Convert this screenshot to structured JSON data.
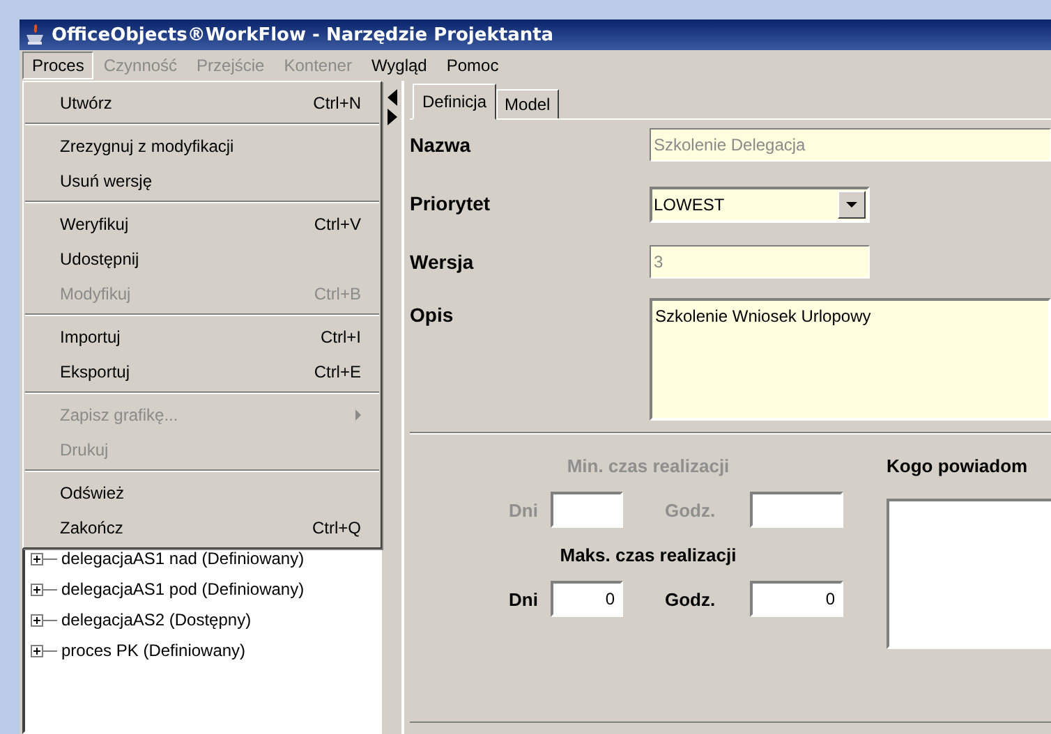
{
  "window": {
    "title": "OfficeObjects®WorkFlow - Narzędzie Projektanta"
  },
  "menubar": [
    {
      "label": "Proces",
      "selected": true,
      "disabled": false
    },
    {
      "label": "Czynność",
      "selected": false,
      "disabled": true
    },
    {
      "label": "Przejście",
      "selected": false,
      "disabled": true
    },
    {
      "label": "Kontener",
      "selected": false,
      "disabled": true
    },
    {
      "label": "Wygląd",
      "selected": false,
      "disabled": false
    },
    {
      "label": "Pomoc",
      "selected": false,
      "disabled": false
    }
  ],
  "menu": {
    "items": [
      {
        "kind": "item",
        "label": "Utwórz",
        "shortcut": "Ctrl+N",
        "disabled": false
      },
      {
        "kind": "separator"
      },
      {
        "kind": "item",
        "label": "Zrezygnuj z modyfikacji",
        "disabled": false
      },
      {
        "kind": "item",
        "label": "Usuń wersję",
        "disabled": false
      },
      {
        "kind": "separator"
      },
      {
        "kind": "item",
        "label": "Weryfikuj",
        "shortcut": "Ctrl+V",
        "disabled": false
      },
      {
        "kind": "item",
        "label": "Udostępnij",
        "disabled": false
      },
      {
        "kind": "item",
        "label": "Modyfikuj",
        "shortcut": "Ctrl+B",
        "disabled": true
      },
      {
        "kind": "separator"
      },
      {
        "kind": "item",
        "label": "Importuj",
        "shortcut": "Ctrl+I",
        "disabled": false
      },
      {
        "kind": "item",
        "label": "Eksportuj",
        "shortcut": "Ctrl+E",
        "disabled": false
      },
      {
        "kind": "separator"
      },
      {
        "kind": "submenu",
        "label": "Zapisz grafikę...",
        "disabled": true
      },
      {
        "kind": "item",
        "label": "Drukuj",
        "disabled": true
      },
      {
        "kind": "separator"
      },
      {
        "kind": "item",
        "label": "Odśwież",
        "disabled": false
      },
      {
        "kind": "item",
        "label": "Zakończ",
        "shortcut": "Ctrl+Q",
        "disabled": false
      }
    ]
  },
  "tree": {
    "items": [
      {
        "label": "delegacjaAS1 nad (Definiowany)",
        "expanded": false
      },
      {
        "label": "delegacjaAS1 pod (Definiowany)",
        "expanded": false
      },
      {
        "label": "delegacjaAS2 (Dostępny)",
        "expanded": false
      },
      {
        "label": "proces PK (Definiowany)",
        "expanded": false
      }
    ]
  },
  "tabs": [
    {
      "label": "Definicja",
      "selected": true
    },
    {
      "label": "Model",
      "selected": false
    }
  ],
  "form": {
    "name": {
      "label": "Nazwa",
      "value": "Szkolenie Delegacja",
      "disabled": true
    },
    "priority": {
      "label": "Priorytet",
      "value": "LOWEST"
    },
    "version": {
      "label": "Wersja",
      "value": "3",
      "disabled": true
    },
    "description": {
      "label": "Opis",
      "value": "Szkolenie Wniosek Urlopowy"
    }
  },
  "min_time": {
    "title": "Min. czas realizacji",
    "disabled": true,
    "days_label": "Dni",
    "hours_label": "Godz."
  },
  "max_time": {
    "title": "Maks. czas realizacji",
    "disabled": false,
    "days_label": "Dni",
    "days_value": "0",
    "hours_label": "Godz.",
    "hours_value": "0"
  },
  "notify": {
    "title": "Kogo powiadom"
  }
}
